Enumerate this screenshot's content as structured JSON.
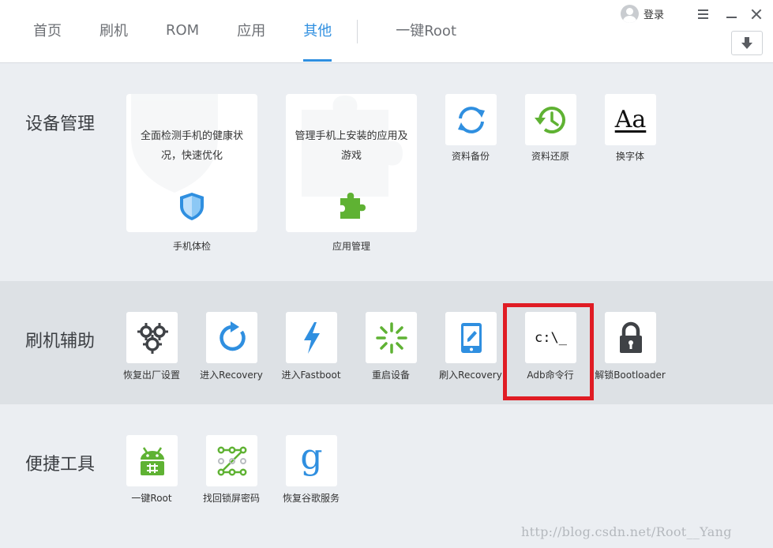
{
  "nav": {
    "tabs": [
      "首页",
      "刷机",
      "ROM",
      "应用",
      "其他"
    ],
    "active_tab": "其他",
    "root_tab": "一键Root"
  },
  "header": {
    "login_label": "登录"
  },
  "sections": {
    "device": {
      "title": "设备管理",
      "cards": [
        {
          "desc": "全面检测手机的健康状况，快速优化",
          "label": "手机体检",
          "icon": "shield-icon"
        },
        {
          "desc": "管理手机上安装的应用及游戏",
          "label": "应用管理",
          "icon": "puzzle-icon"
        }
      ],
      "tiles": [
        {
          "label": "资料备份",
          "icon": "sync-icon"
        },
        {
          "label": "资料还原",
          "icon": "restore-clock-icon"
        },
        {
          "label": "换字体",
          "icon": "font-icon",
          "glyph": "Aa"
        }
      ]
    },
    "flash": {
      "title": "刷机辅助",
      "tiles": [
        {
          "label": "恢复出厂设置",
          "icon": "gears-icon"
        },
        {
          "label": "进入Recovery",
          "icon": "refresh-icon"
        },
        {
          "label": "进入Fastboot",
          "icon": "lightning-icon"
        },
        {
          "label": "重启设备",
          "icon": "loading-spinner-icon"
        },
        {
          "label": "刷入Recovery",
          "icon": "tablet-edit-icon"
        },
        {
          "label": "Adb命令行",
          "icon": "terminal-icon",
          "glyph": "c:\\_"
        },
        {
          "label": "解锁Bootloader",
          "icon": "padlock-icon"
        }
      ]
    },
    "tools": {
      "title": "便捷工具",
      "tiles": [
        {
          "label": "一键Root",
          "icon": "android-icon"
        },
        {
          "label": "找回锁屏密码",
          "icon": "pattern-lock-icon"
        },
        {
          "label": "恢复谷歌服务",
          "icon": "google-icon",
          "glyph": "g"
        }
      ]
    }
  },
  "watermark": "http://blog.csdn.net/Root__Yang",
  "colors": {
    "accent": "#2f8fe0",
    "green": "#5fb233",
    "highlight": "#e01c24",
    "section_bg": "#ebeef2",
    "band_bg": "#dde1e5"
  }
}
